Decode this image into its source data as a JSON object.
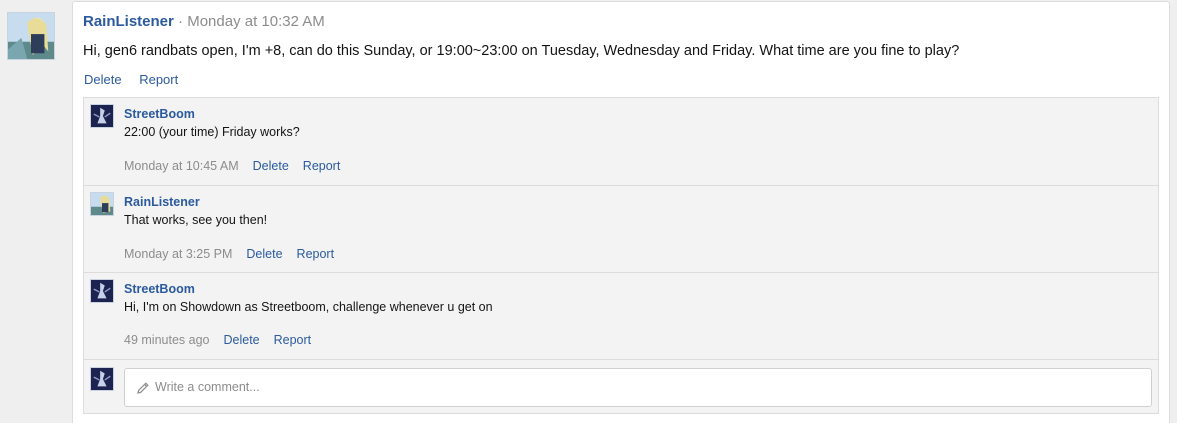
{
  "post": {
    "author": "RainListener",
    "separator": " · ",
    "time": "Monday at 10:32 AM",
    "text": "Hi, gen6 randbats open, I'm +8, can do this Sunday, or 19:00~23:00 on Tuesday, Wednesday and Friday. What time are you fine to play?",
    "actions": {
      "delete": "Delete",
      "report": "Report"
    }
  },
  "replies": [
    {
      "author": "StreetBoom",
      "text": "22:00 (your time) Friday works?",
      "time": "Monday at 10:45 AM",
      "delete": "Delete",
      "report": "Report"
    },
    {
      "author": "RainListener",
      "text": "That works, see you then!",
      "time": "Monday at 3:25 PM",
      "delete": "Delete",
      "report": "Report"
    },
    {
      "author": "StreetBoom",
      "text": "Hi, I'm on Showdown as Streetboom, challenge whenever u get on",
      "time": "49 minutes ago",
      "delete": "Delete",
      "report": "Report"
    }
  ],
  "composer": {
    "placeholder": "Write a comment..."
  },
  "icons": {
    "pencil": "pencil-icon"
  },
  "colors": {
    "link": "#2b5a9f",
    "muted": "#8c8c8c",
    "thread_bg": "#f3f3f3"
  }
}
